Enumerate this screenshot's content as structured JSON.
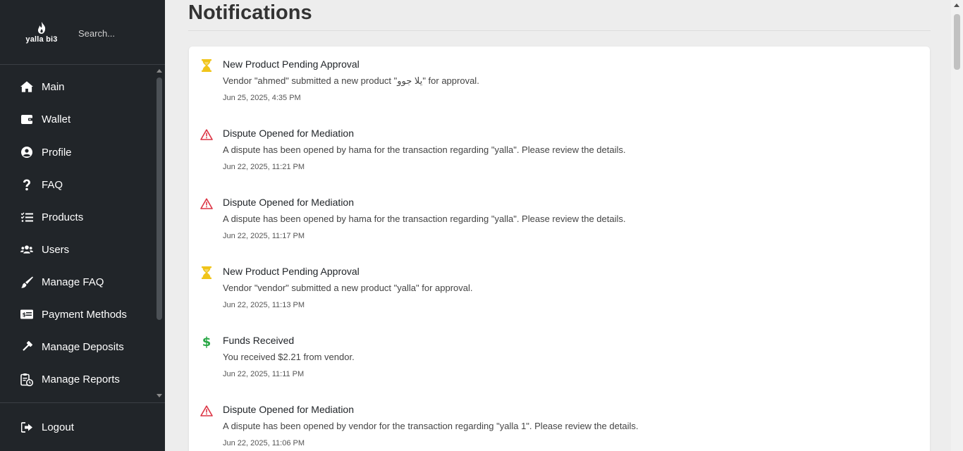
{
  "sidebar": {
    "logo_text": "yalla bi3",
    "search_placeholder": "Search...",
    "items": [
      {
        "label": "Main",
        "icon": "home-icon"
      },
      {
        "label": "Wallet",
        "icon": "wallet-icon"
      },
      {
        "label": "Profile",
        "icon": "user-circle-icon"
      },
      {
        "label": "FAQ",
        "icon": "question-icon"
      },
      {
        "label": "Products",
        "icon": "list-check-icon"
      },
      {
        "label": "Users",
        "icon": "users-icon"
      },
      {
        "label": "Manage FAQ",
        "icon": "brush-icon"
      },
      {
        "label": "Payment Methods",
        "icon": "money-check-icon"
      },
      {
        "label": "Manage Deposits",
        "icon": "gavel-icon"
      },
      {
        "label": "Manage Reports",
        "icon": "clipboard-clock-icon"
      }
    ],
    "logout_label": "Logout"
  },
  "main": {
    "title": "Notifications",
    "notifications": [
      {
        "type": "hourglass-icon",
        "title": "New Product Pending Approval",
        "message": "Vendor \"ahmed\" submitted a new product \"يلا جوو\" for approval.",
        "time": "Jun 25, 2025, 4:35 PM"
      },
      {
        "type": "warning-icon",
        "title": "Dispute Opened for Mediation",
        "message": "A dispute has been opened by hama for the transaction regarding \"yalla\". Please review the details.",
        "time": "Jun 22, 2025, 11:21 PM"
      },
      {
        "type": "warning-icon",
        "title": "Dispute Opened for Mediation",
        "message": "A dispute has been opened by hama for the transaction regarding \"yalla\". Please review the details.",
        "time": "Jun 22, 2025, 11:17 PM"
      },
      {
        "type": "hourglass-icon",
        "title": "New Product Pending Approval",
        "message": "Vendor \"vendor\" submitted a new product \"yalla\" for approval.",
        "time": "Jun 22, 2025, 11:13 PM"
      },
      {
        "type": "dollar-icon",
        "title": "Funds Received",
        "message": "You received $2.21 from vendor.",
        "time": "Jun 22, 2025, 11:11 PM"
      },
      {
        "type": "warning-icon",
        "title": "Dispute Opened for Mediation",
        "message": "A dispute has been opened by vendor for the transaction regarding \"yalla 1\". Please review the details.",
        "time": "Jun 22, 2025, 11:06 PM"
      }
    ]
  },
  "colors": {
    "sidebar_bg": "#212529",
    "hourglass": "#f0c419",
    "warning": "#dc3545",
    "dollar": "#28a745"
  }
}
